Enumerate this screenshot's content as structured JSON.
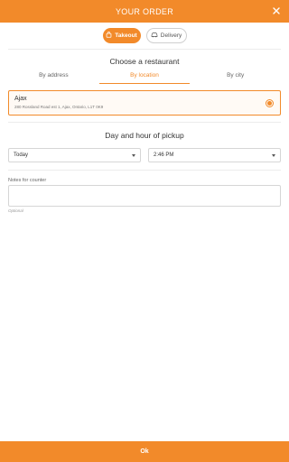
{
  "header": {
    "title": "YOUR ORDER",
    "close_icon": "close-icon"
  },
  "order_mode": {
    "options": [
      {
        "label": "Takeout",
        "icon": "bag-icon",
        "selected": true
      },
      {
        "label": "Delivery",
        "icon": "car-icon",
        "selected": false
      }
    ]
  },
  "restaurant": {
    "section_title": "Choose a restaurant",
    "tabs": [
      {
        "label": "By address",
        "active": false
      },
      {
        "label": "By location",
        "active": true
      },
      {
        "label": "By city",
        "active": false
      }
    ],
    "selected": {
      "name": "Ajax",
      "address": "280 Rossland Road est 1, Ajax, Ontario, L1T 0K9"
    }
  },
  "pickup": {
    "section_title": "Day and hour of pickup",
    "day": "Today",
    "time": "2:46 PM"
  },
  "notes": {
    "label": "Notes for counter",
    "value": "",
    "hint": "Optional"
  },
  "footer": {
    "ok_label": "Ok"
  },
  "colors": {
    "accent": "#f28a2a"
  }
}
